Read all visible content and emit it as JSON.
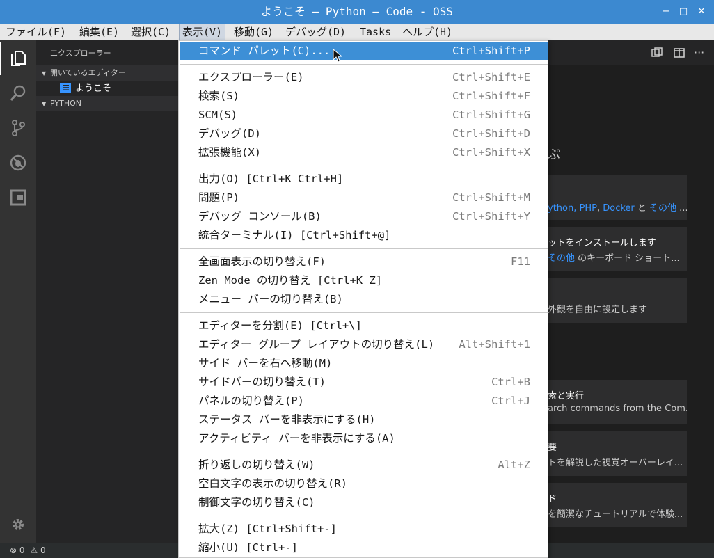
{
  "window": {
    "title": "ようこそ — Python — Code - OSS",
    "minimize": "−",
    "maximize": "□",
    "close": "✕"
  },
  "menubar": {
    "items": [
      "ファイル(F)",
      "編集(E)",
      "選択(C)",
      "表示(V)",
      "移動(G)",
      "デバッグ(D)",
      "Tasks",
      "ヘルプ(H)"
    ],
    "active": "表示(V)"
  },
  "sidebar": {
    "header": "エクスプローラー",
    "open_editors": "開いているエディター",
    "open_file": "ようこそ",
    "folder": "PYTHON"
  },
  "view_menu": {
    "groups": [
      [
        {
          "label": "コマンド パレット(C)...",
          "key": "Ctrl+Shift+P",
          "highlighted": true
        }
      ],
      [
        {
          "label": "エクスプローラー(E)",
          "key": "Ctrl+Shift+E"
        },
        {
          "label": "検索(S)",
          "key": "Ctrl+Shift+F"
        },
        {
          "label": "SCM(S)",
          "key": "Ctrl+Shift+G"
        },
        {
          "label": "デバッグ(D)",
          "key": "Ctrl+Shift+D"
        },
        {
          "label": "拡張機能(X)",
          "key": "Ctrl+Shift+X"
        }
      ],
      [
        {
          "label": "出力(O) [Ctrl+K Ctrl+H]",
          "key": ""
        },
        {
          "label": "問題(P)",
          "key": "Ctrl+Shift+M"
        },
        {
          "label": "デバッグ コンソール(B)",
          "key": "Ctrl+Shift+Y"
        },
        {
          "label": "統合ターミナル(I) [Ctrl+Shift+@]",
          "key": ""
        }
      ],
      [
        {
          "label": "全画面表示の切り替え(F)",
          "key": "F11"
        },
        {
          "label": "Zen Mode の切り替え [Ctrl+K Z]",
          "key": ""
        },
        {
          "label": "メニュー バーの切り替え(B)",
          "key": ""
        }
      ],
      [
        {
          "label": "エディターを分割(E) [Ctrl+\\]",
          "key": ""
        },
        {
          "label": "エディター グループ レイアウトの切り替え(L)",
          "key": "Alt+Shift+1"
        },
        {
          "label": "サイド バーを右へ移動(M)",
          "key": ""
        },
        {
          "label": "サイドバーの切り替え(T)",
          "key": "Ctrl+B"
        },
        {
          "label": "パネルの切り替え(P)",
          "key": "Ctrl+J"
        },
        {
          "label": "ステータス バーを非表示にする(H)",
          "key": ""
        },
        {
          "label": "アクティビティ バーを非表示にする(A)",
          "key": ""
        }
      ],
      [
        {
          "label": "折り返しの切り替え(W)",
          "key": "Alt+Z"
        },
        {
          "label": "空白文字の表示の切り替え(R)",
          "key": ""
        },
        {
          "label": "制御文字の切り替え(C)",
          "key": ""
        }
      ],
      [
        {
          "label": "拡大(Z) [Ctrl+Shift+-]",
          "key": ""
        },
        {
          "label": "縮小(U) [Ctrl+-]",
          "key": ""
        }
      ]
    ]
  },
  "welcome": {
    "heading1_fragment": "ぷ",
    "card1": {
      "prefix": "ython, ",
      "link1": "PHP",
      "sep": ", ",
      "link2": "Docker",
      "and": " と ",
      "link3": "その他",
      "suffix": " ..."
    },
    "card2": {
      "line1": "ットをインストールします",
      "link": "その他",
      "line2": " のキーボード ショート..."
    },
    "card3": {
      "line2": "外観を自由に設定します"
    },
    "card4": {
      "line1": "索と実行",
      "line2": "arch commands from the Com..."
    },
    "card5": {
      "line1": "要",
      "line2": "トを解説した視覚オーバーレイ..."
    },
    "card6": {
      "line1": "ド",
      "line2": "を簡潔なチュートリアルで体験..."
    }
  },
  "statusbar": {
    "errors": "0",
    "warnings": "0"
  },
  "colors": {
    "titlebar": "#3c89d0",
    "menu_highlight": "#3d8fd6",
    "activitybar": "#333333",
    "sidebar": "#252526",
    "editor": "#1e1e1e",
    "link": "#3794ff"
  }
}
